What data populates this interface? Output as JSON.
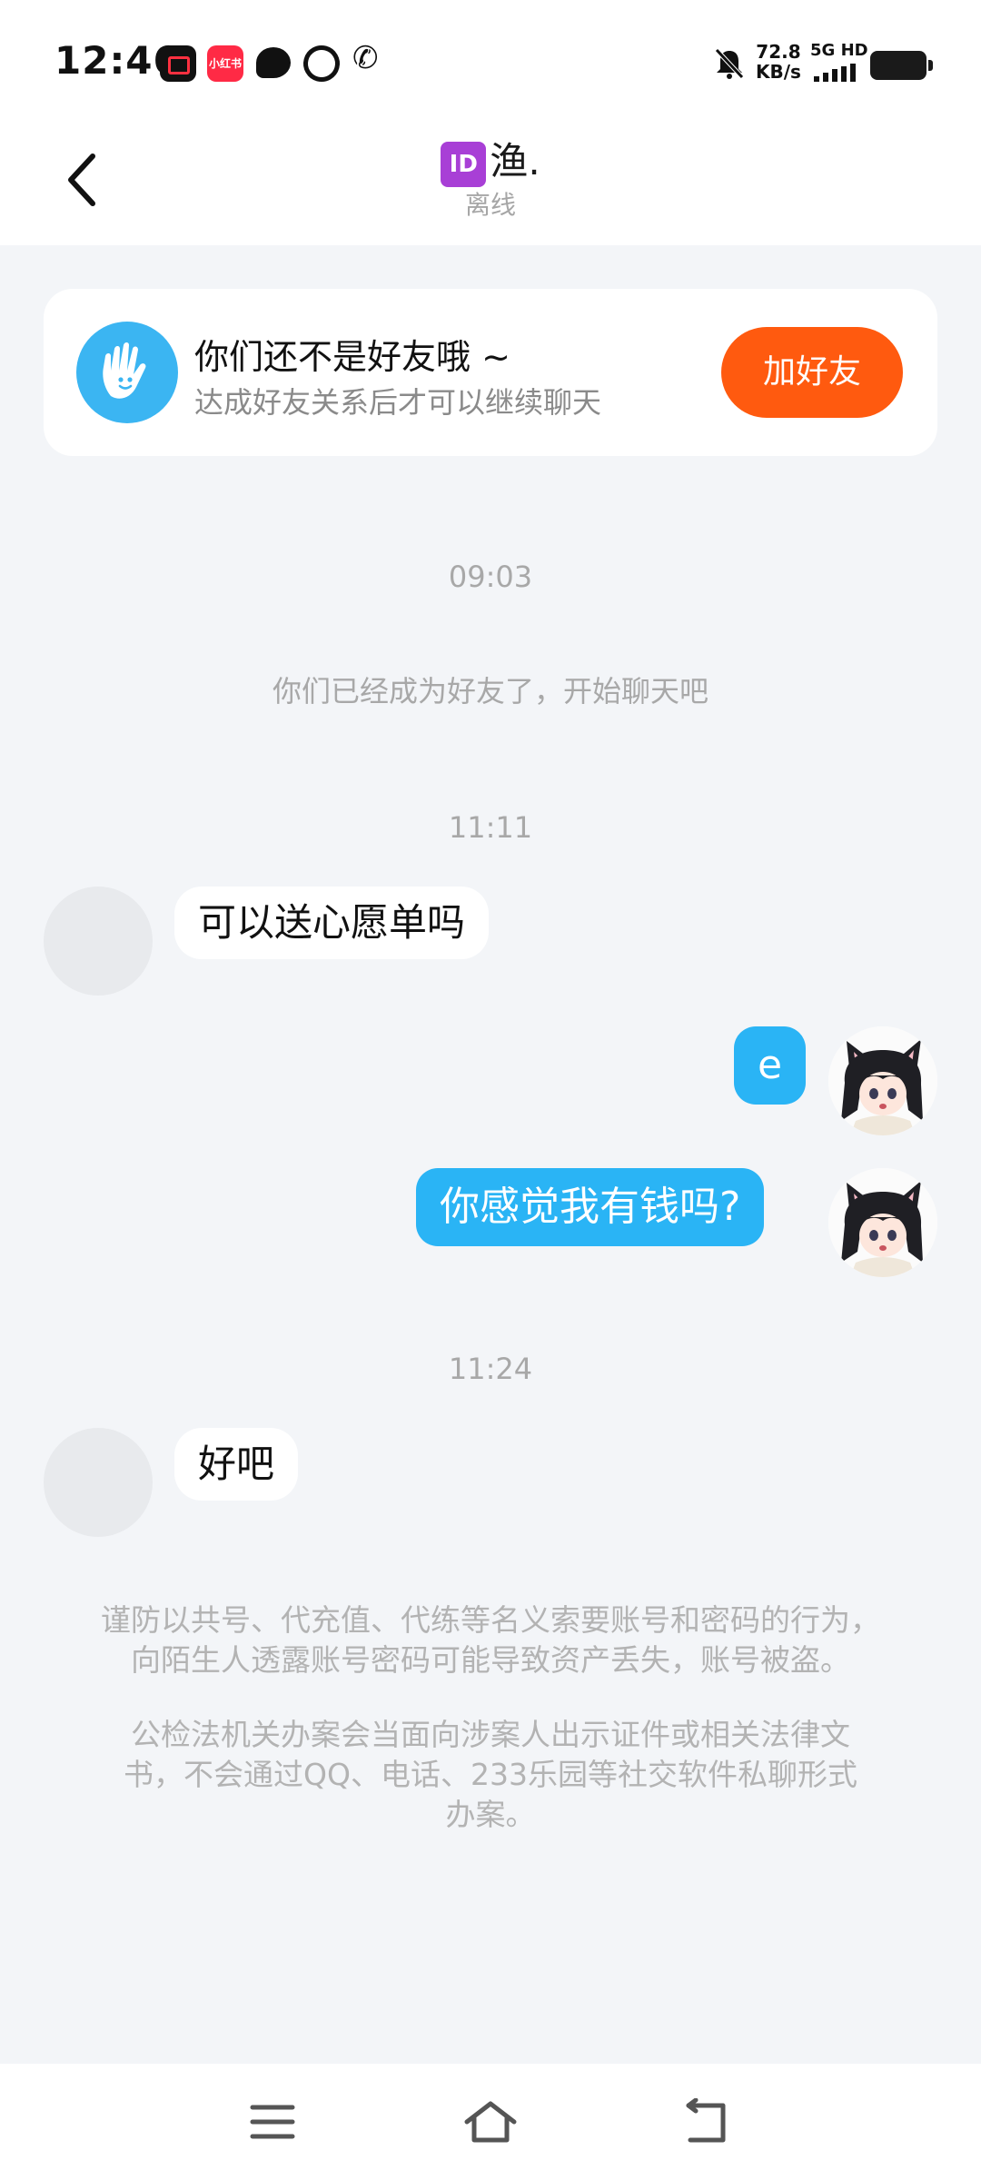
{
  "status_bar": {
    "time": "12:46",
    "speed_value": "72.8",
    "speed_unit": "KB/s",
    "network": "5G HD",
    "app_icon_xhs": "小红书"
  },
  "header": {
    "badge": "ID",
    "title": "渔.",
    "status": "离线"
  },
  "friend_card": {
    "title": "你们还不是好友哦 ~",
    "subtitle": "达成好友关系后才可以继续聊天",
    "button": "加好友"
  },
  "chat": {
    "timestamps": [
      "09:03",
      "11:11",
      "11:24"
    ],
    "system_message": "你们已经成为好友了，开始聊天吧",
    "messages": [
      {
        "side": "in",
        "text": "可以送心愿单吗"
      },
      {
        "side": "out",
        "text": "e"
      },
      {
        "side": "out",
        "text": "你感觉我有钱吗?"
      },
      {
        "side": "in",
        "text": "好吧"
      }
    ]
  },
  "notice": {
    "line1": "谨防以共号、代充值、代练等名义索要账号和密码的行为，",
    "line2": "向陌生人透露账号密码可能导致资产丢失，账号被盗。",
    "line3": "公检法机关办案会当面向涉案人出示证件或相关法律文",
    "line4": "书，不会通过QQ、电话、233乐园等社交软件私聊形式",
    "line5": "办案。"
  },
  "colors": {
    "accent_orange": "#ff5a0f",
    "bubble_blue": "#2ab4f5",
    "id_badge_purple": "#a83fd6"
  }
}
